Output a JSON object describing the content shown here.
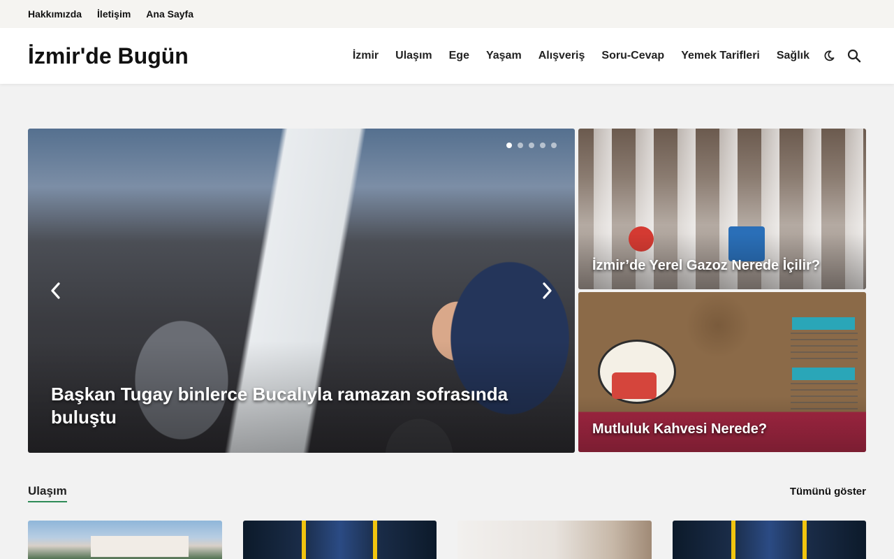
{
  "topbar": {
    "links": [
      "Hakkımızda",
      "İletişim",
      "Ana Sayfa"
    ]
  },
  "header": {
    "site_title": "İzmir'de Bugün",
    "nav": [
      "İzmir",
      "Ulaşım",
      "Ege",
      "Yaşam",
      "Alışveriş",
      "Soru-Cevap",
      "Yemek Tarifleri",
      "Sağlık"
    ],
    "icons": [
      "moon-icon",
      "search-icon"
    ]
  },
  "slider": {
    "caption": "Başkan Tugay binlerce Bucalıyla ramazan sofrasında buluştu",
    "dot_count": 5,
    "active_dot": 1,
    "icons": [
      "chevron-left-icon",
      "chevron-right-icon"
    ]
  },
  "side_cards": [
    {
      "title": "İzmir’de Yerel Gazoz Nerede İçilir?"
    },
    {
      "title": "Mutluluk Kahvesi Nerede?"
    }
  ],
  "section": {
    "title": "Ulaşım",
    "show_all": "Tümünü göster",
    "accent_color": "#2e8b57"
  }
}
